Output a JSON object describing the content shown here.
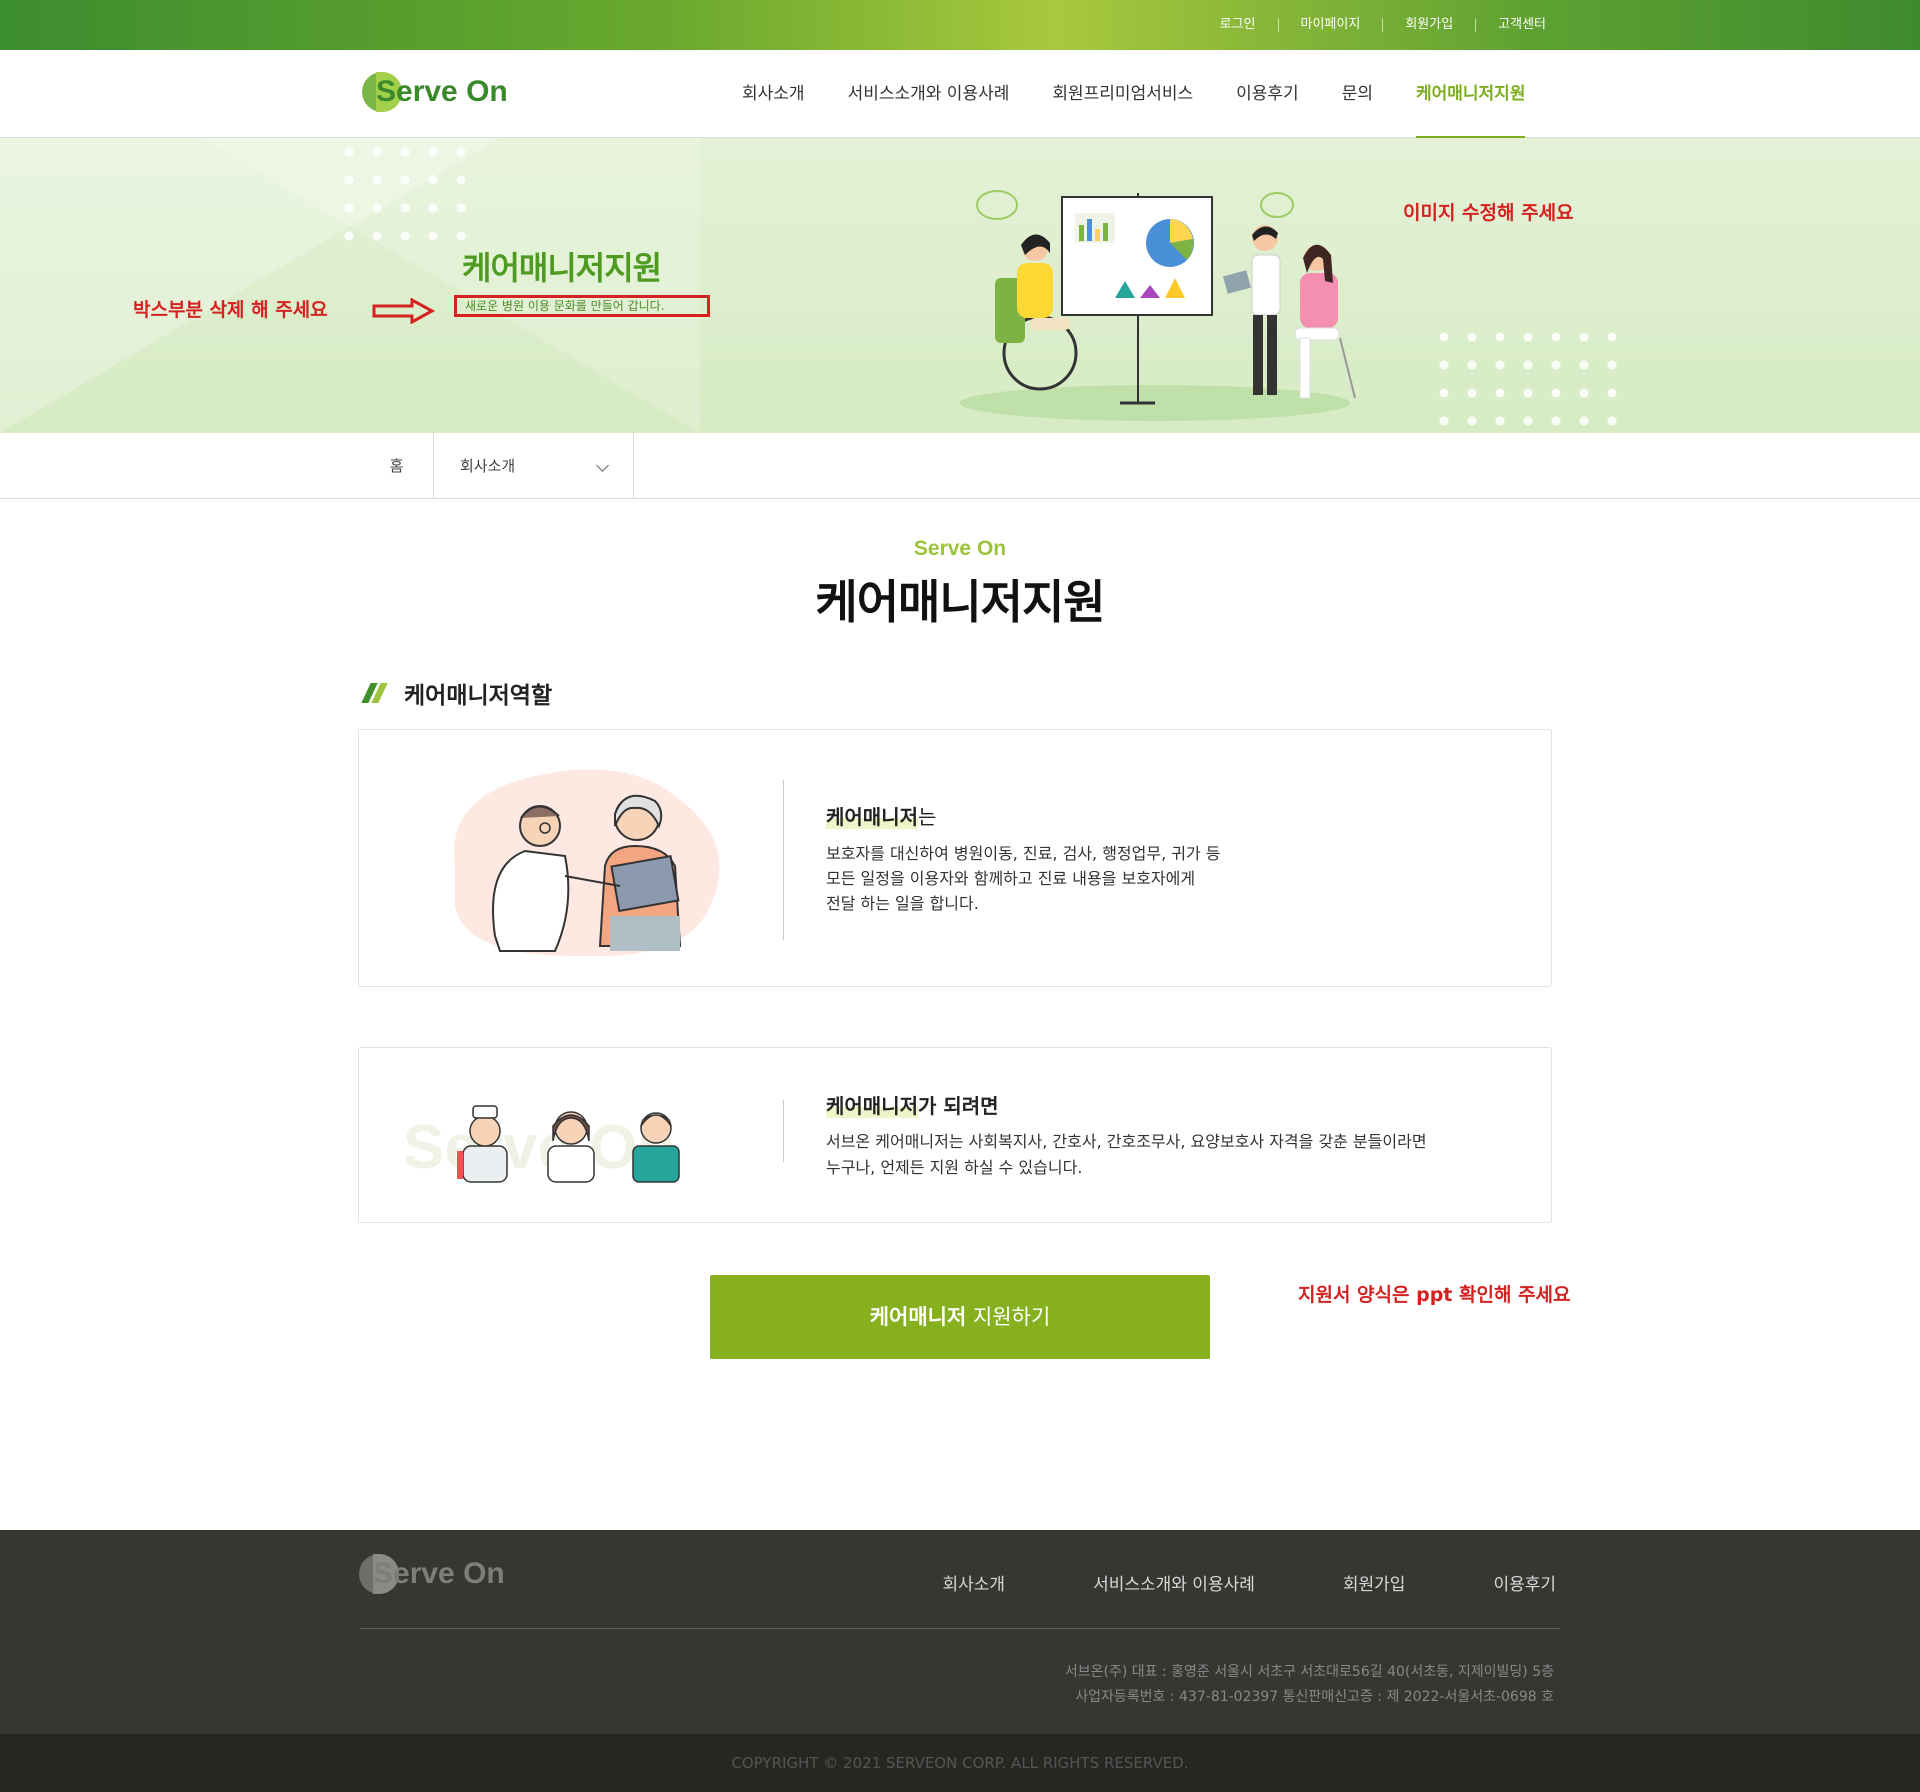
{
  "topbar": {
    "links": [
      "로그인",
      "마이페이지",
      "회원가입",
      "고객센터"
    ]
  },
  "header": {
    "logo": "Serve On",
    "nav": [
      "회사소개",
      "서비스소개와 이용사례",
      "회원프리미엄서비스",
      "이용후기",
      "문의",
      "케어매니저지원"
    ],
    "active_nav": "케어매니저지원"
  },
  "hero": {
    "title": "케어매니저지원",
    "subtitle": "새로운 병원 이용 문화를 만들어 갑니다.",
    "note_delete_box": "박스부분 삭제 해 주세요",
    "note_edit_image": "이미지 수정해 주세요"
  },
  "breadcrumb": {
    "home": "홈",
    "selected": "회사소개"
  },
  "section": {
    "eyebrow": "Serve On",
    "title": "케어매니저지원",
    "subheading": "케어매니저역할"
  },
  "card1": {
    "title_highlight": "케어매니저",
    "title_rest": "는",
    "lines": [
      "보호자를 대신하여 병원이동, 진료, 검사, 행정업무, 귀가 등",
      "모든 일정을 이용자와 함께하고 진료 내용을 보호자에게",
      "전달 하는 일을 합니다."
    ]
  },
  "card2": {
    "title_highlight": "케어매니저",
    "title_rest": "가 되려면",
    "lines": [
      "서브온 케어매니저는 사회복지사, 간호사, 간호조무사, 요양보호사 자격을 갖춘 분들이라면",
      "누구나, 언제든 지원 하실 수 있습니다."
    ]
  },
  "apply": {
    "bold": "케어매니저",
    "rest": " 지원하기",
    "note": "지원서 양식은 ppt 확인해 주세요"
  },
  "footer": {
    "logo": "Serve On",
    "nav": [
      "회사소개",
      "서비스소개와 이용사례",
      "회원가입",
      "이용후기"
    ],
    "info_line1": "서브온(주) 대표 : 홍영준 서울시 서초구 서초대로56길 40(서초동, 지제이빌딩) 5층",
    "info_line2": "사업자등록번호 : 437-81-02397  통신판매신고증 : 제 2022-서울서초-0698 호",
    "copyright": "COPYRIGHT © 2021 SERVEON CORP. ALL RIGHTS RESERVED."
  },
  "colors": {
    "brand_green": "#7cae1e",
    "button_green": "#86b01d",
    "note_red": "#d62121",
    "footer_bg": "#363732"
  }
}
